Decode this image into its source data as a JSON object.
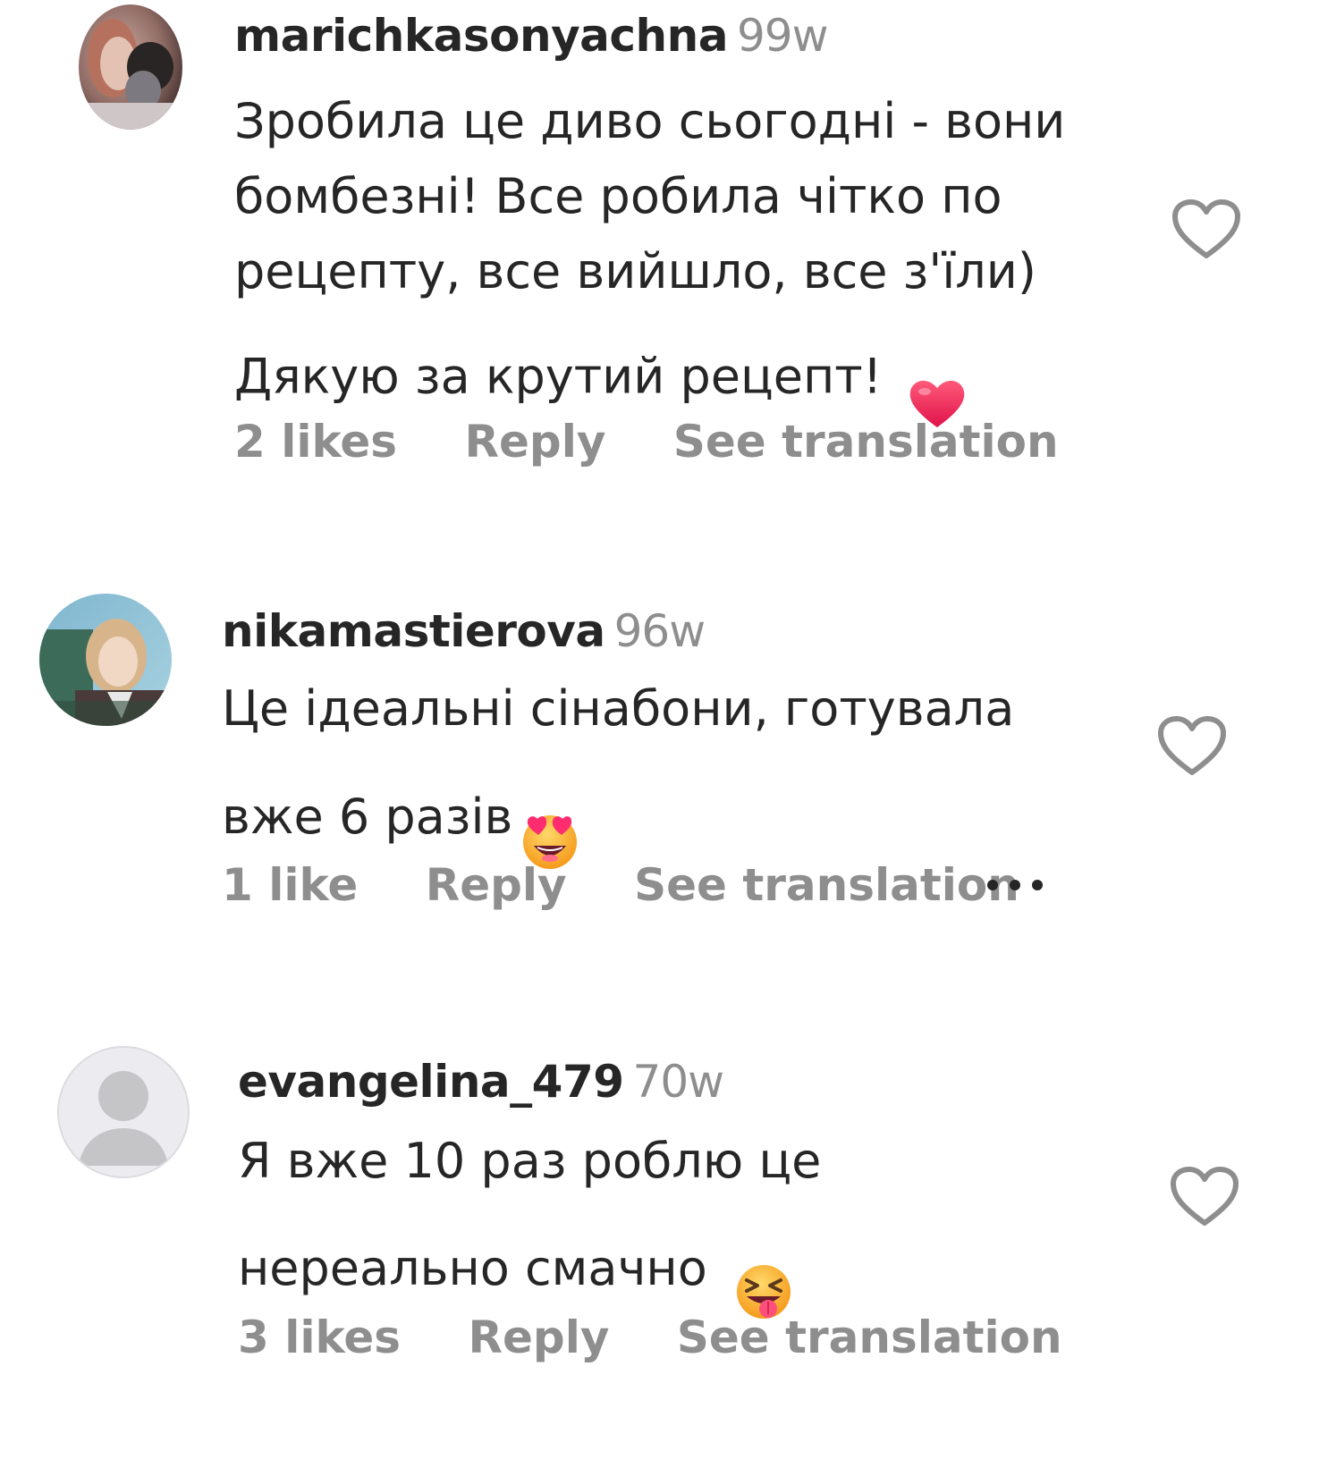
{
  "comments": [
    {
      "username": "marichkasonyachna",
      "time": "99w",
      "text": "Зробила це диво сьогодні - вони\nбомбезні! Все робила чітко по\nрецепту, все вийшло, все з'їли)\nДякую за крутий рецепт!",
      "emoji": "red-heart-emoji",
      "likes": "2 likes",
      "reply": "Reply",
      "translation": "See translation",
      "avatar": "photo-avatar"
    },
    {
      "username": "nikamastierova",
      "time": "96w",
      "text": "Це ідеальні сінабони, готувала\nвже 6 разів",
      "emoji": "heart-eyes-emoji",
      "likes": "1 like",
      "reply": "Reply",
      "translation": "See translation",
      "avatar": "photo-avatar",
      "more_icon": "more-icon"
    },
    {
      "username": "evangelina_479",
      "time": "70w",
      "text": "Я вже 10 раз роблю це\nнереально смачно",
      "emoji": "tongue-out-emoji",
      "likes": "3 likes",
      "reply": "Reply",
      "translation": "See translation",
      "avatar": "default-avatar"
    }
  ],
  "colors": {
    "text": "#262626",
    "secondary": "#8e8e8e",
    "heart_outline": "#8e8e8e",
    "red_heart": "#f0325a"
  }
}
